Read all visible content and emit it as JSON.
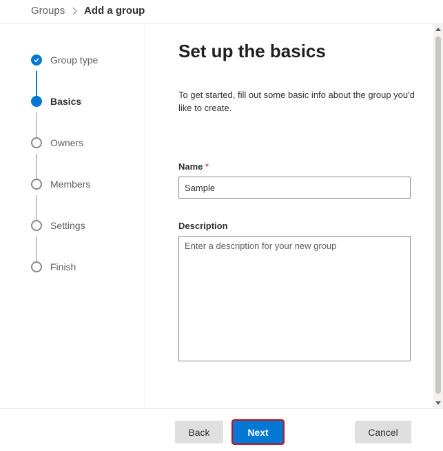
{
  "breadcrumb": {
    "root": "Groups",
    "current": "Add a group"
  },
  "steps": [
    {
      "label": "Group type",
      "state": "done"
    },
    {
      "label": "Basics",
      "state": "active"
    },
    {
      "label": "Owners",
      "state": "pending"
    },
    {
      "label": "Members",
      "state": "pending"
    },
    {
      "label": "Settings",
      "state": "pending"
    },
    {
      "label": "Finish",
      "state": "pending"
    }
  ],
  "main": {
    "title": "Set up the basics",
    "intro": "To get started, fill out some basic info about the group you'd like to create.",
    "name_label": "Name",
    "required_marker": "*",
    "name_value": "Sample",
    "description_label": "Description",
    "description_placeholder": "Enter a description for your new group"
  },
  "footer": {
    "back_label": "Back",
    "next_label": "Next",
    "cancel_label": "Cancel"
  },
  "colors": {
    "accent": "#0078d4",
    "highlight_border": "#c50f1f",
    "required": "#a4262c"
  }
}
